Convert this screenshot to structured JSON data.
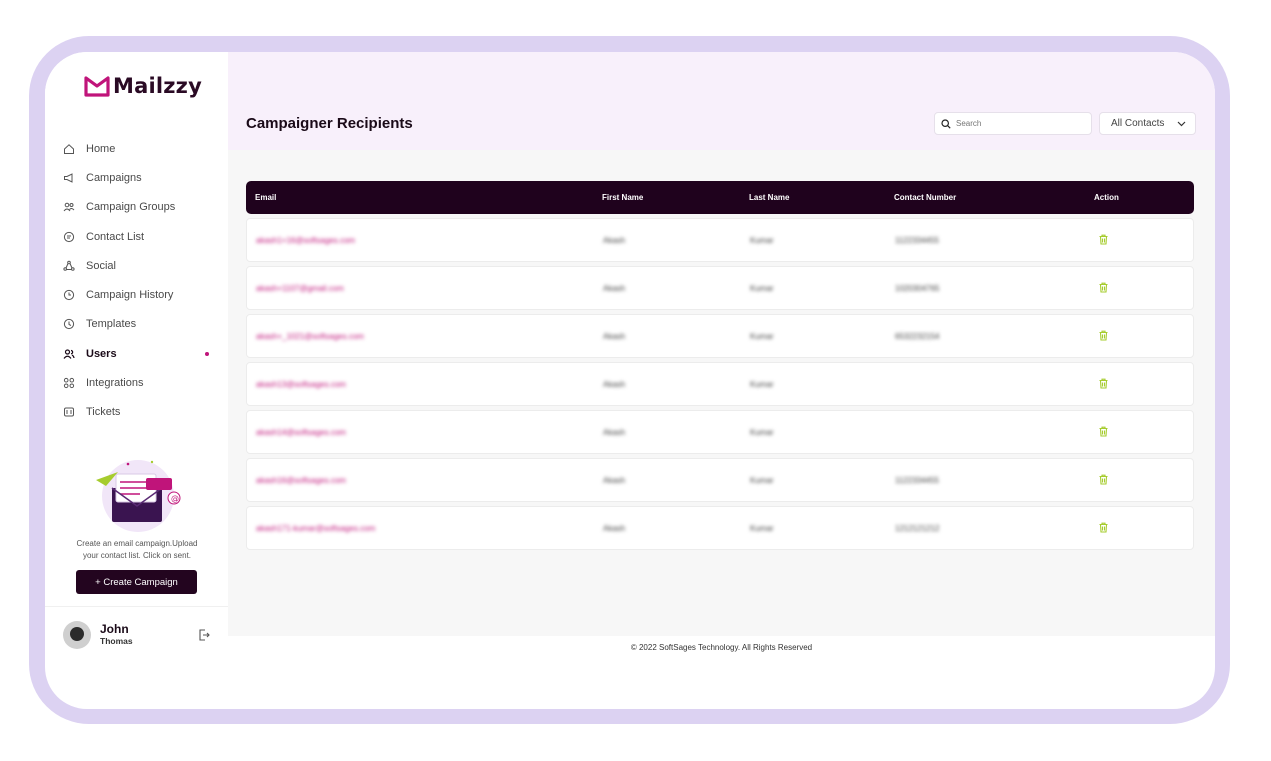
{
  "app": {
    "name": "Mailzzy"
  },
  "sidebar": {
    "items": [
      {
        "label": "Home",
        "icon": "home-icon"
      },
      {
        "label": "Campaigns",
        "icon": "megaphone-icon"
      },
      {
        "label": "Campaign Groups",
        "icon": "users-group-icon"
      },
      {
        "label": "Contact List",
        "icon": "contact-icon"
      },
      {
        "label": "Social",
        "icon": "social-icon"
      },
      {
        "label": "Campaign History",
        "icon": "history-icon"
      },
      {
        "label": "Templates",
        "icon": "template-icon"
      },
      {
        "label": "Users",
        "icon": "users-icon",
        "active": true
      },
      {
        "label": "Integrations",
        "icon": "grid-icon"
      },
      {
        "label": "Tickets",
        "icon": "ticket-icon"
      }
    ],
    "promo_text": "Create an email campaign.Upload your contact list. Click on sent.",
    "create_label": "+  Create Campaign"
  },
  "profile": {
    "name": "John",
    "surname": "Thomas"
  },
  "header": {
    "title": "Campaigner Recipients",
    "search_placeholder": "Search",
    "filter_value": "All Contacts"
  },
  "table": {
    "columns": [
      "Email",
      "First Name",
      "Last Name",
      "Contact Number",
      "Action"
    ],
    "rows": [
      {
        "email": "akash1+16@softsages.com",
        "first": "Akash",
        "last": "Kumar",
        "phone": "1122334455"
      },
      {
        "email": "akash+1107@gmail.com",
        "first": "Akash",
        "last": "Kumar",
        "phone": "1020304765"
      },
      {
        "email": "akash+_1021@softsages.com",
        "first": "Akash",
        "last": "Kumar",
        "phone": "6532232154"
      },
      {
        "email": "akash13@softsages.com",
        "first": "Akash",
        "last": "Kumar",
        "phone": ""
      },
      {
        "email": "akash14@softsages.com",
        "first": "Akash",
        "last": "Kumar",
        "phone": ""
      },
      {
        "email": "akash16@softsages.com",
        "first": "Akash",
        "last": "Kumar",
        "phone": "1122334455"
      },
      {
        "email": "akash171-kumar@softsages.com",
        "first": "Akash",
        "last": "Kumar",
        "phone": "1212121212"
      }
    ]
  },
  "footer": {
    "text": "© 2022 SoftSages Technology. All Rights Reserved"
  },
  "colors": {
    "brand": "#c0147a",
    "dark": "#1f021d",
    "trash": "#a6cc2e",
    "frame": "#dcd2f2"
  }
}
